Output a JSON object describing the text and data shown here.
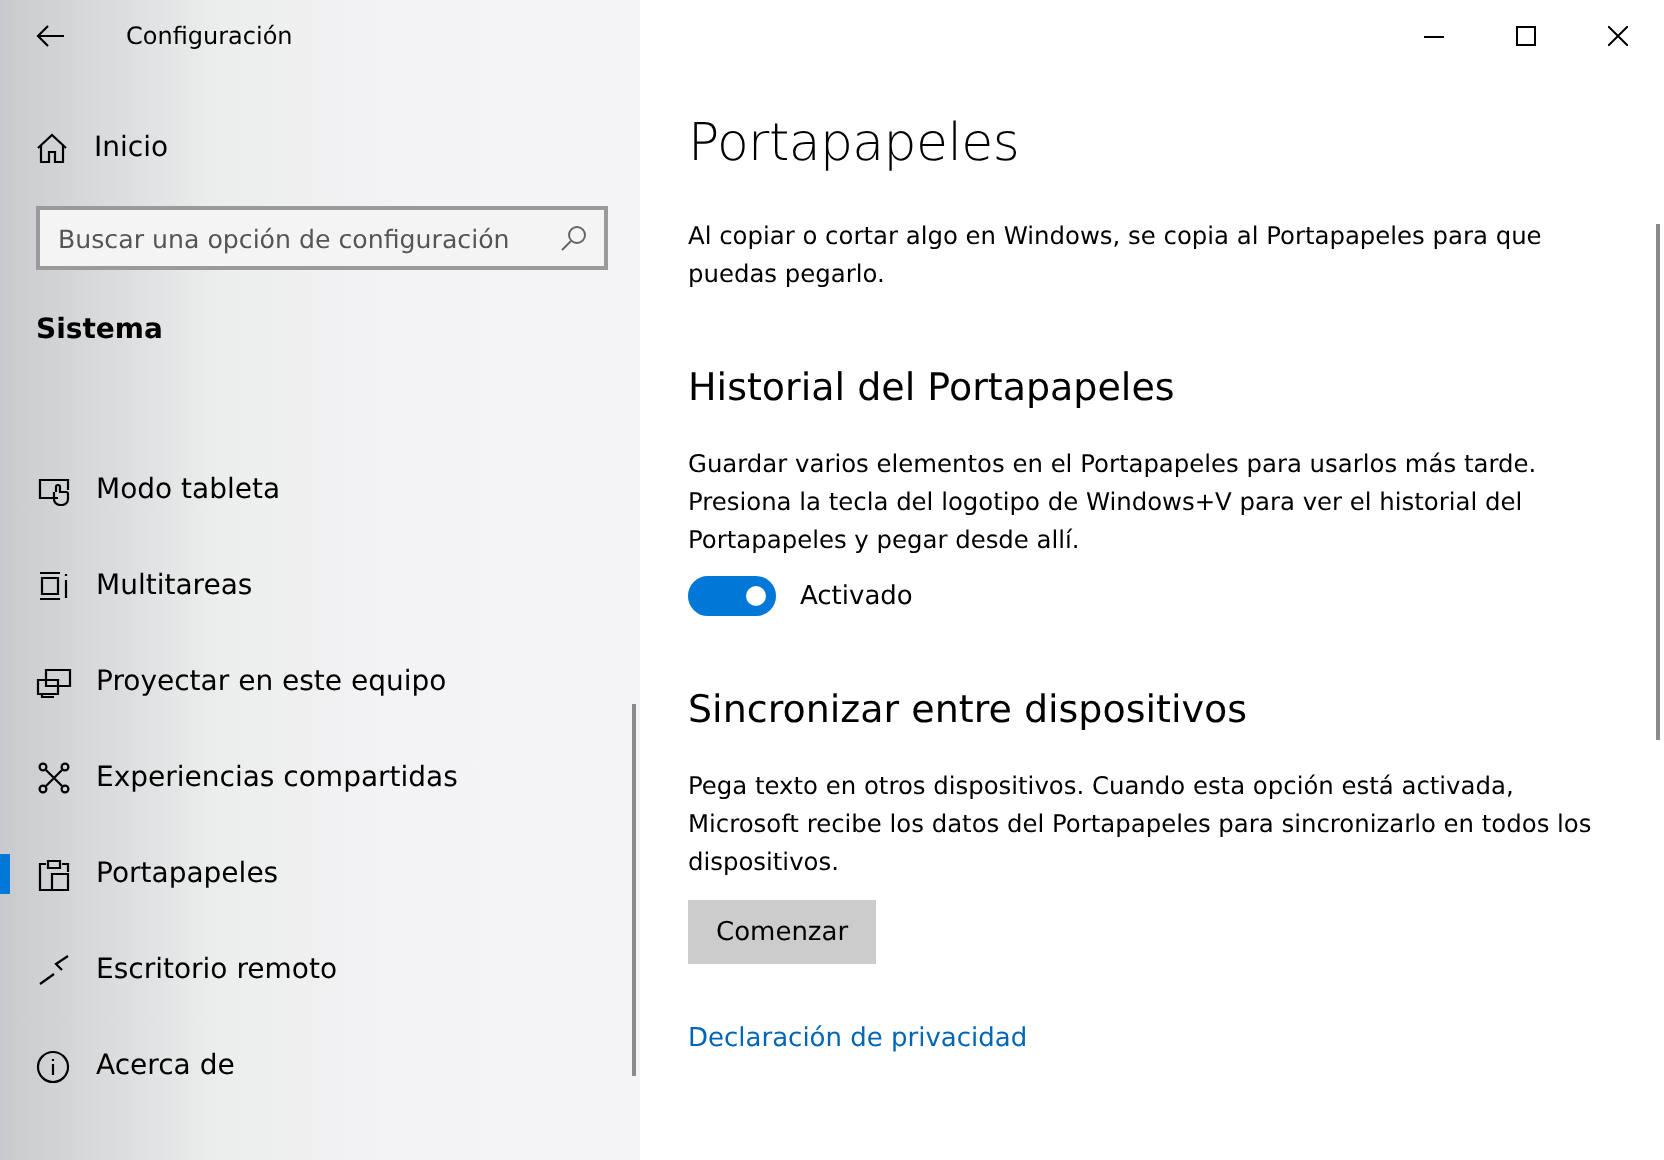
{
  "window": {
    "title": "Configuración"
  },
  "sidebar": {
    "home": "Inicio",
    "search": {
      "placeholder": "Buscar una opción de configuración"
    },
    "section": "Sistema",
    "items": [
      {
        "label": "Modo tableta",
        "selected": false
      },
      {
        "label": "Multitareas",
        "selected": false
      },
      {
        "label": "Proyectar en este equipo",
        "selected": false
      },
      {
        "label": "Experiencias compartidas",
        "selected": false
      },
      {
        "label": "Portapapeles",
        "selected": true
      },
      {
        "label": "Escritorio remoto",
        "selected": false
      },
      {
        "label": "Acerca de",
        "selected": false
      }
    ]
  },
  "content": {
    "title": "Portapapeles",
    "intro": "Al copiar o cortar algo en Windows, se copia al Portapapeles para que puedas pegarlo.",
    "sections": [
      {
        "kind": "toggle",
        "heading": "Historial del Portapapeles",
        "text": "Guardar varios elementos en el Portapapeles para usarlos más tarde. Presiona la tecla del logotipo de Windows+V para ver el historial del Portapapeles y pegar desde allí.",
        "on": true,
        "label": "Activado"
      },
      {
        "kind": "button",
        "heading": "Sincronizar entre dispositivos",
        "text": "Pega texto en otros dispositivos. Cuando esta opción está activada, Microsoft recibe los datos del Portapapeles para sincronizarlo en todos los dispositivos.",
        "button": "Comenzar"
      }
    ],
    "link": "Declaración de privacidad"
  }
}
